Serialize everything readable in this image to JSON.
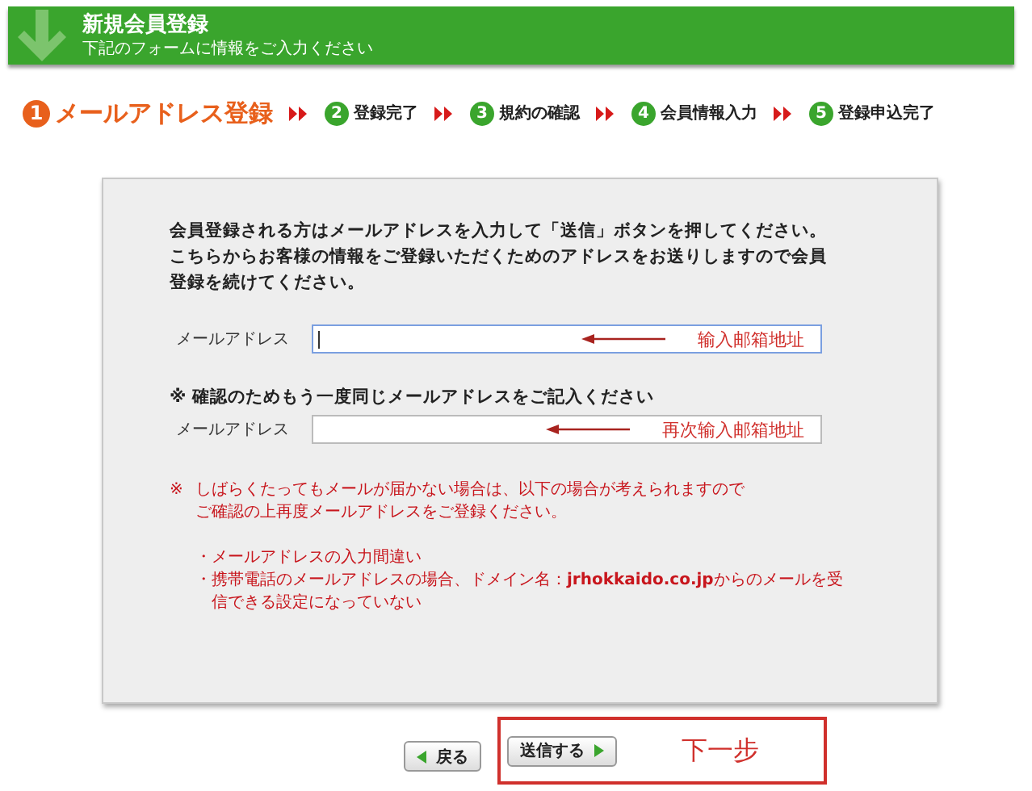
{
  "header": {
    "title": "新規会員登録",
    "subtitle": "下記のフォームに情報をご入力ください"
  },
  "steps": [
    {
      "number": "1",
      "label": "メールアドレス登録",
      "selected": true
    },
    {
      "number": "2",
      "label": "登録完了",
      "selected": false
    },
    {
      "number": "3",
      "label": "規約の確認",
      "selected": false
    },
    {
      "number": "4",
      "label": "会員情報入力",
      "selected": false
    },
    {
      "number": "5",
      "label": "登録申込完了",
      "selected": false
    }
  ],
  "intro": [
    "会員登録される方はメールアドレスを入力して「送信」ボタンを押してください。",
    "こちらからお客様の情報をご登録いただくためのアドレスをお送りしますので会員",
    "登録を続けてください。"
  ],
  "fields": [
    {
      "label": "メールアドレス",
      "focused": true,
      "annotation": "输入邮箱地址"
    },
    {
      "label": "メールアドレス",
      "focused": false,
      "note": "※ 確認のためもう一度同じメールアドレスをご記入ください",
      "annotation": "再次输入邮箱地址"
    }
  ],
  "warning": {
    "mark": "※",
    "lines": [
      "しばらくたってもメールが届かない場合は、以下の場合が考えられますので",
      "ご確認の上再度メールアドレスをご登録ください。"
    ],
    "items": [
      {
        "bullet": "・",
        "lines": [
          "メールアドレスの入力間違い"
        ]
      },
      {
        "bullet": "・",
        "lines": [
          "携帯電話のメールアドレスの場合、ドメイン名：**jrhokkaido.co.jp**からのメールを受",
          "信できる設定になっていない"
        ]
      }
    ]
  },
  "buttons": [
    {
      "label": "戻る",
      "kind": "back"
    },
    {
      "label": "送信する",
      "kind": "next"
    }
  ],
  "next_annotation": "下一步"
}
